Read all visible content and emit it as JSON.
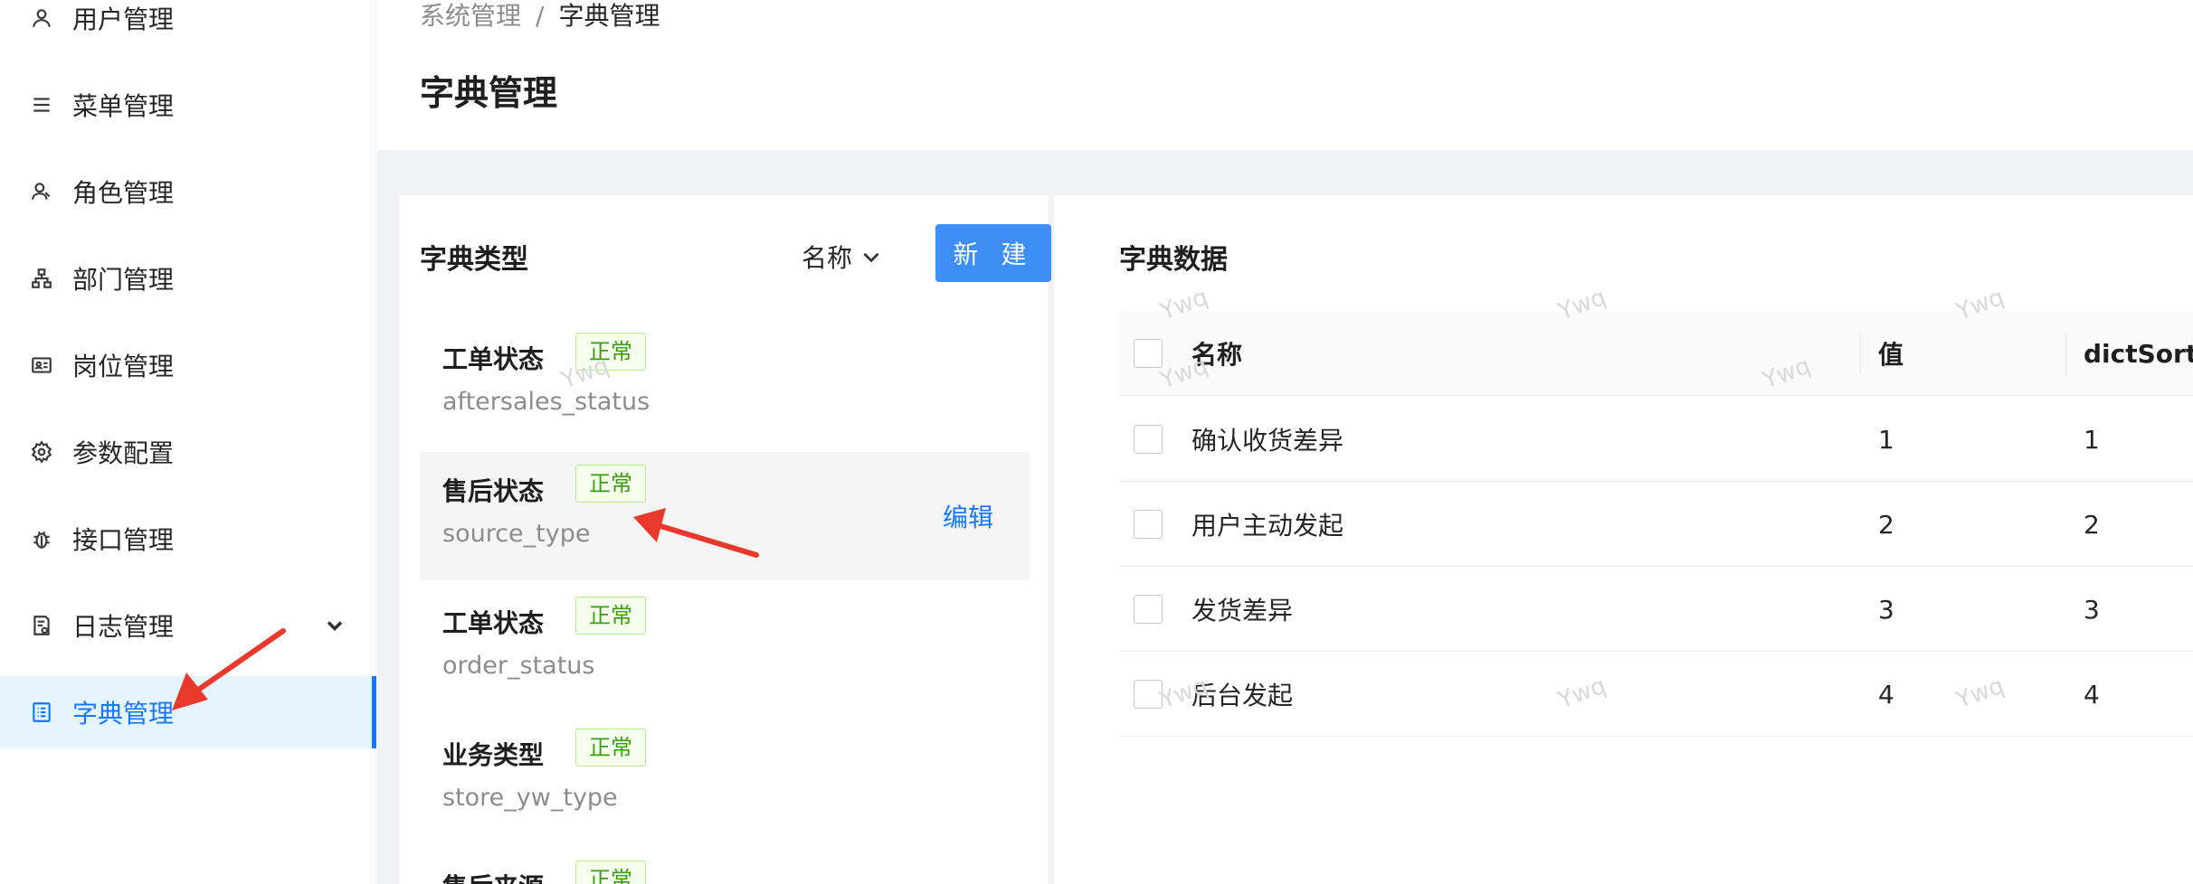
{
  "sidebar": {
    "items": [
      {
        "label": "用户管理",
        "icon": "user-icon"
      },
      {
        "label": "菜单管理",
        "icon": "menu-list-icon"
      },
      {
        "label": "角色管理",
        "icon": "role-icon"
      },
      {
        "label": "部门管理",
        "icon": "department-icon"
      },
      {
        "label": "岗位管理",
        "icon": "id-card-icon"
      },
      {
        "label": "参数配置",
        "icon": "gear-icon"
      },
      {
        "label": "接口管理",
        "icon": "bug-icon"
      },
      {
        "label": "日志管理",
        "icon": "log-icon"
      },
      {
        "label": "字典管理",
        "icon": "dictionary-icon"
      }
    ]
  },
  "header": {
    "breadcrumb_parent": "系统管理",
    "breadcrumb_sep": "/",
    "breadcrumb_current": "字典管理",
    "title": "字典管理"
  },
  "dict_types": {
    "title": "字典类型",
    "sort_label": "名称",
    "new_button": "新 建",
    "edit_label": "编辑",
    "items": [
      {
        "name": "工单状态",
        "status": "正常",
        "code": "aftersales_status"
      },
      {
        "name": "售后状态",
        "status": "正常",
        "code": "source_type"
      },
      {
        "name": "工单状态",
        "status": "正常",
        "code": "order_status"
      },
      {
        "name": "业务类型",
        "status": "正常",
        "code": "store_yw_type"
      },
      {
        "name": "售后来源",
        "status": "正常",
        "code": ""
      }
    ]
  },
  "dict_data": {
    "title": "字典数据",
    "columns": {
      "name": "名称",
      "value": "值",
      "sort": "dictSort"
    },
    "rows": [
      {
        "name": "确认收货差异",
        "value": "1",
        "sort": "1"
      },
      {
        "name": "用户主动发起",
        "value": "2",
        "sort": "2"
      },
      {
        "name": "发货差异",
        "value": "3",
        "sort": "3"
      },
      {
        "name": "后台发起",
        "value": "4",
        "sort": "4"
      }
    ]
  },
  "watermark": "Ywq",
  "colors": {
    "primary": "#1677ff",
    "button": "#3f8ef5",
    "tag_green": "#389e0d",
    "annotation_red": "#e8392c"
  }
}
